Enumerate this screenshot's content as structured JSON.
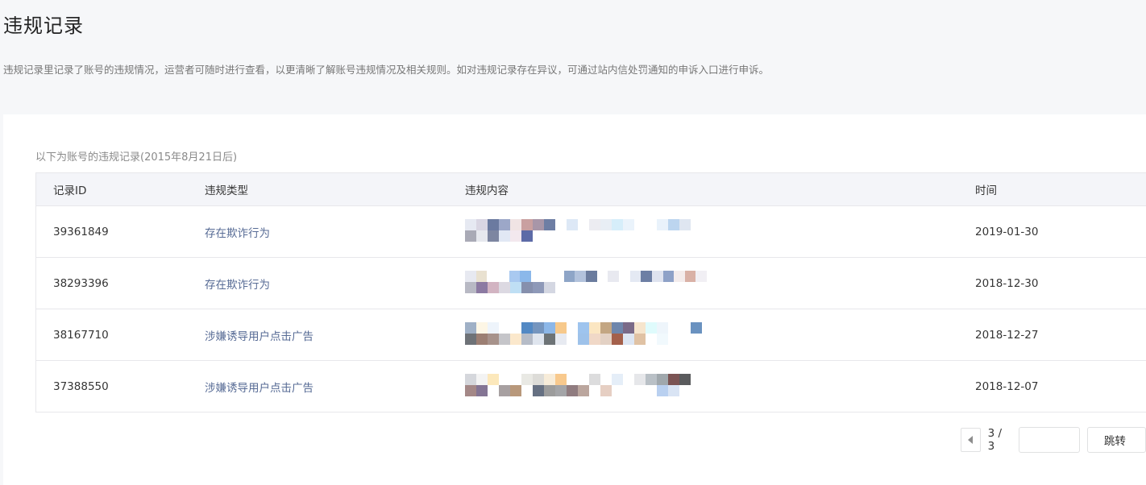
{
  "page": {
    "title": "违规记录",
    "description": "违规记录里记录了账号的违规情况，运营者可随时进行查看，以更清晰了解账号违规情况及相关规则。如对违规记录存在异议，可通过站内信处罚通知的申诉入口进行申诉。"
  },
  "records": {
    "caption": "以下为账号的违规记录(2015年8月21日后)",
    "headers": {
      "id": "记录ID",
      "type": "违规类型",
      "content": "违规内容",
      "time": "时间"
    },
    "rows": [
      {
        "id": "39361849",
        "type": "存在欺诈行为",
        "content": "(pixelated)",
        "time": "2019-01-30"
      },
      {
        "id": "38293396",
        "type": "存在欺诈行为",
        "content": "(pixelated)",
        "time": "2018-12-30"
      },
      {
        "id": "38167710",
        "type": "涉嫌诱导用户点击广告",
        "content": "(pixelated)",
        "time": "2018-12-27"
      },
      {
        "id": "37388550",
        "type": "涉嫌诱导用户点击广告",
        "content": "(pixelated)",
        "time": "2018-12-07"
      }
    ]
  },
  "pagination": {
    "page_text": "3 / 3",
    "jump_input_value": "",
    "jump_label": "跳转"
  },
  "colors": {
    "link": "#576b95",
    "page_bg": "#f6f7f9",
    "header_bg": "#f4f5f9"
  }
}
